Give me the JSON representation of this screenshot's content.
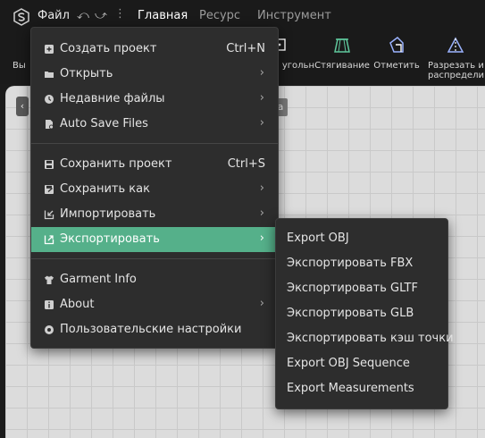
{
  "menubar": {
    "file_label": "Файл",
    "tabs": [
      {
        "label": "Главная",
        "active": true
      },
      {
        "label": "Ресурс",
        "active": false
      },
      {
        "label": "Инструмент",
        "active": false
      }
    ]
  },
  "toolbar": {
    "items": [
      {
        "label": "Вы",
        "icon": "tool-icon"
      },
      {
        "label": "угольн",
        "icon": "rectangle-icon"
      },
      {
        "label": "Стягивание",
        "icon": "stretch-icon"
      },
      {
        "label": "Отметить",
        "icon": "mark-icon"
      },
      {
        "label_line1": "Разрезать и",
        "label_line2": "распредели",
        "icon": "cut-distribute-icon"
      }
    ]
  },
  "canvas": {
    "badge": "a"
  },
  "file_menu": {
    "items": [
      {
        "label": "Создать проект",
        "shortcut": "Ctrl+N",
        "icon": "new-project-icon"
      },
      {
        "label": "Открыть",
        "arrow": "›",
        "icon": "folder-open-icon"
      },
      {
        "label": "Недавние файлы",
        "arrow": "›",
        "icon": "clock-icon"
      },
      {
        "label": "Auto Save Files",
        "arrow": "›",
        "icon": "autosave-file-icon"
      },
      {
        "label": "Сохранить проект",
        "shortcut": "Ctrl+S",
        "icon": "save-icon"
      },
      {
        "label": "Сохранить как",
        "arrow": "›",
        "icon": "save-as-icon"
      },
      {
        "label": "Импортировать",
        "arrow": "›",
        "icon": "import-icon"
      },
      {
        "label": "Экспортировать",
        "arrow": "›",
        "icon": "export-icon",
        "highlighted": true
      },
      {
        "label": "Garment Info",
        "icon": "garment-icon"
      },
      {
        "label": "About",
        "arrow": "›",
        "icon": "info-icon"
      },
      {
        "label": "Пользовательские настройки",
        "icon": "settings-icon"
      }
    ]
  },
  "export_submenu": {
    "items": [
      "Export OBJ",
      "Экспортировать FBX",
      "Экспортировать GLTF",
      "Экспортировать GLB",
      "Экспортировать кэш точки",
      "Export OBJ Sequence",
      "Export Measurements"
    ]
  },
  "colors": {
    "highlight": "#55b08a",
    "menu_bg": "#2d2d2d",
    "app_bg": "#1a1a1a",
    "canvas_bg": "#dcdcdc"
  }
}
